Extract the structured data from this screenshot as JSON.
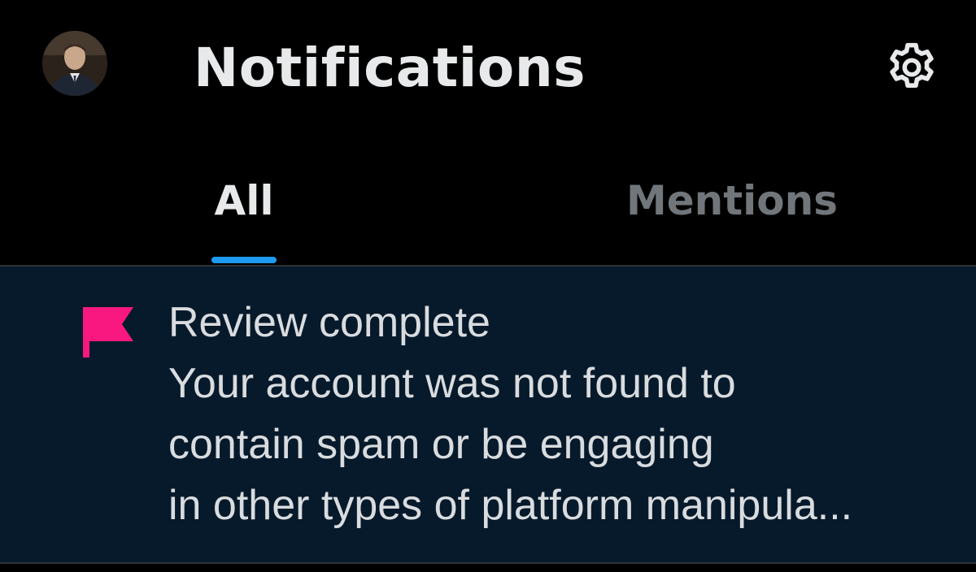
{
  "header": {
    "title": "Notifications",
    "avatar_icon": "user-avatar",
    "settings_icon": "gear-icon"
  },
  "tabs": [
    {
      "label": "All",
      "active": true
    },
    {
      "label": "Mentions",
      "active": false
    }
  ],
  "notifications": [
    {
      "icon": "flag-icon",
      "icon_color": "#f91880",
      "lines": [
        "Review complete",
        "Your account was not found to",
        "contain spam or be engaging",
        "in other types of platform manipula..."
      ]
    }
  ],
  "colors": {
    "background": "#000000",
    "notification_background": "#071a2b",
    "accent": "#1d9bf0",
    "text_primary": "#e7e9ea",
    "text_secondary": "#71767b"
  }
}
